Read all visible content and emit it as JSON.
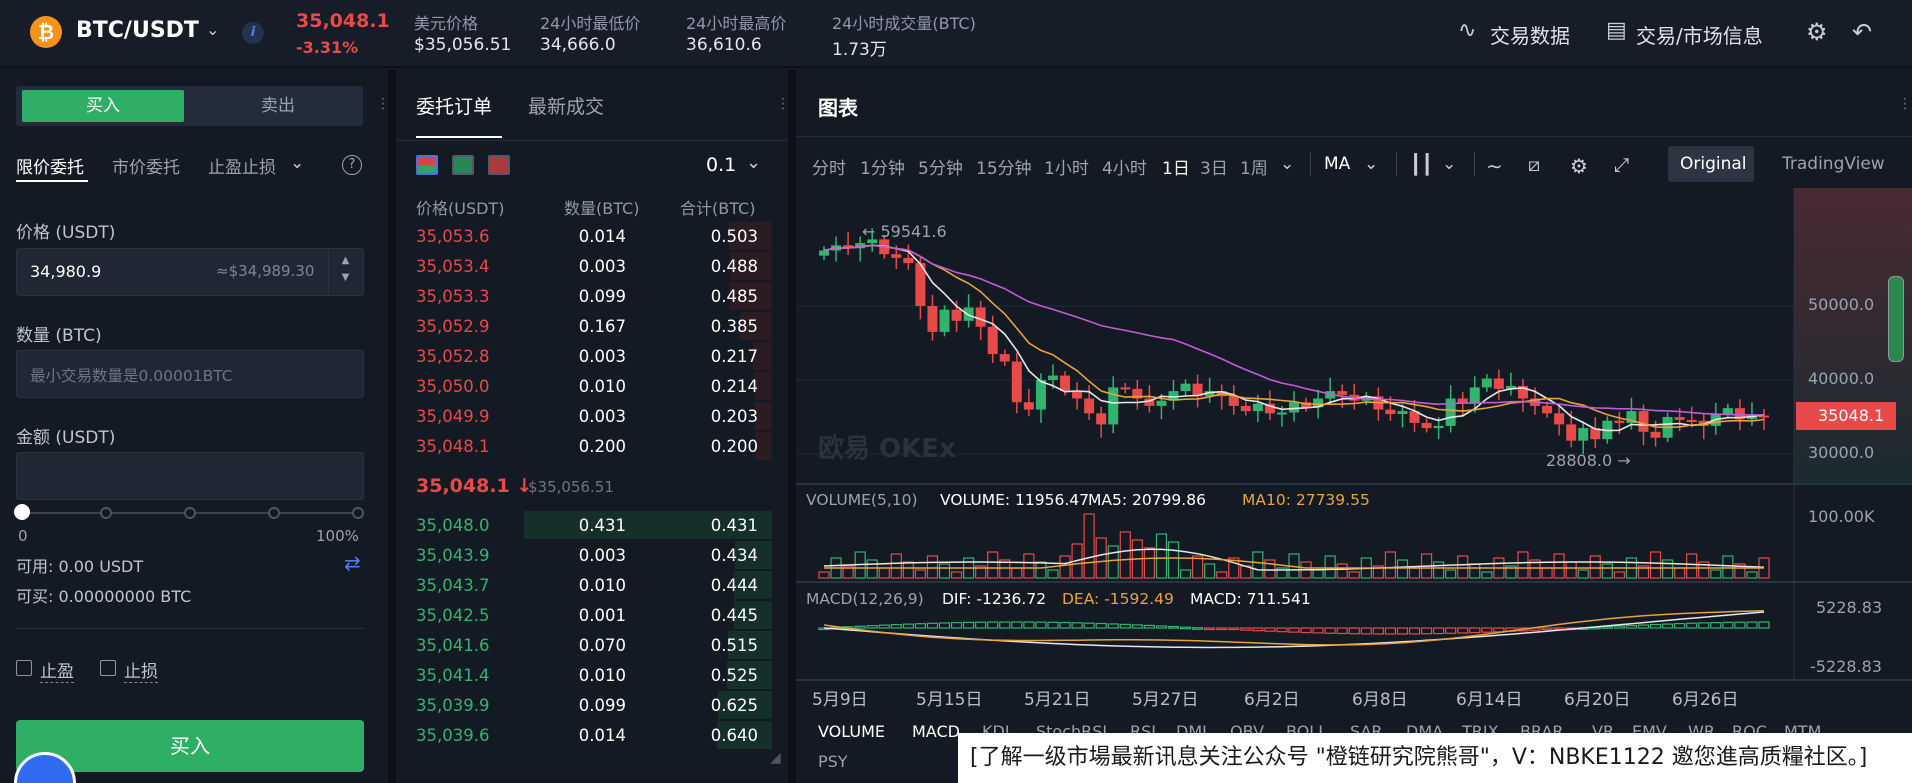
{
  "header": {
    "pair": "BTC/USDT",
    "last_price": "35,048.1",
    "change_pct": "-3.31%",
    "stats": [
      {
        "label": "美元价格",
        "value": "$35,056.51"
      },
      {
        "label": "24小时最低价",
        "value": "34,666.0"
      },
      {
        "label": "24小时最高价",
        "value": "36,610.6"
      },
      {
        "label": "24小时成交量(BTC)",
        "value": "1.73万"
      }
    ],
    "link_trade_data": "交易数据",
    "link_market_info": "交易/市场信息"
  },
  "trade": {
    "buy_tab": "买入",
    "sell_tab": "卖出",
    "order_types": [
      "限价委托",
      "市价委托",
      "止盈止损"
    ],
    "price_label": "价格 (USDT)",
    "price_value": "34,980.9",
    "price_usd": "≈$34,989.30",
    "qty_label": "数量 (BTC)",
    "qty_placeholder": "最小交易数量是0.00001BTC",
    "amount_label": "金额 (USDT)",
    "slider_min": "0",
    "slider_max": "100%",
    "slider_value_pct": 0,
    "available": "可用: 0.00 USDT",
    "can_buy": "可买: 0.00000000 BTC",
    "take_profit": "止盈",
    "stop_loss": "止损",
    "buy_button": "买入"
  },
  "orderbook": {
    "tab_orders": "委托订单",
    "tab_trades": "最新成交",
    "precision": "0.1",
    "col_price": "价格(USDT)",
    "col_qty": "数量(BTC)",
    "col_total": "合计(BTC)",
    "asks": [
      [
        "35,053.6",
        "0.014",
        "0.503"
      ],
      [
        "35,053.4",
        "0.003",
        "0.488"
      ],
      [
        "35,053.3",
        "0.099",
        "0.485"
      ],
      [
        "35,052.9",
        "0.167",
        "0.385"
      ],
      [
        "35,052.8",
        "0.003",
        "0.217"
      ],
      [
        "35,050.0",
        "0.010",
        "0.214"
      ],
      [
        "35,049.9",
        "0.003",
        "0.203"
      ],
      [
        "35,048.1",
        "0.200",
        "0.200"
      ]
    ],
    "mid_price": "35,048.1 ↓",
    "mid_usd": "$35,056.51",
    "bids": [
      [
        "35,048.0",
        "0.431",
        "0.431"
      ],
      [
        "35,043.9",
        "0.003",
        "0.434"
      ],
      [
        "35,043.7",
        "0.010",
        "0.444"
      ],
      [
        "35,042.5",
        "0.001",
        "0.445"
      ],
      [
        "35,041.6",
        "0.070",
        "0.515"
      ],
      [
        "35,041.4",
        "0.010",
        "0.525"
      ],
      [
        "35,039.9",
        "0.099",
        "0.625"
      ],
      [
        "35,039.6",
        "0.014",
        "0.640"
      ]
    ]
  },
  "chart": {
    "title": "图表",
    "intervals": [
      "分时",
      "1分钟",
      "5分钟",
      "15分钟",
      "1小时",
      "4小时",
      "1日",
      "3日",
      "1周"
    ],
    "active_interval": "1日",
    "ma_label": "MA",
    "view_original": "Original",
    "view_tv": "TradingView",
    "price_axis": [
      "50000.0",
      "40000.0",
      "30000.0"
    ],
    "current_price_tag": "35048.1",
    "high_marker": "← 59541.6",
    "low_marker": "28808.0 →",
    "watermark": "欧易 OKEx",
    "volume_legend": {
      "name": "VOLUME(5,10)",
      "vol": "VOLUME: 11956.47",
      "ma5": "MA5: 20799.86",
      "ma10": "MA10: 27739.55"
    },
    "volume_axis": "100.00K",
    "macd_legend": {
      "name": "MACD(12,26,9)",
      "dif": "DIF: -1236.72",
      "dea": "DEA: -1592.49",
      "macd": "MACD: 711.541"
    },
    "macd_axis_top": "5228.83",
    "macd_axis_bottom": "-5228.83",
    "x_dates": [
      "5月9日",
      "5月15日",
      "5月21日",
      "5月27日",
      "6月2日",
      "6月8日",
      "6月14日",
      "6月20日",
      "6月26日"
    ],
    "indicators": [
      "VOLUME",
      "MACD",
      "KDJ",
      "StochRSI",
      "RSI",
      "DMI",
      "OBV",
      "BOLL",
      "SAR",
      "DMA",
      "TRIX",
      "BRAR",
      "VR",
      "EMV",
      "WR",
      "ROC",
      "MTM",
      "PSY"
    ],
    "colors": {
      "up": "#31b46f",
      "down": "#e84a4a",
      "ma_white": "#e6e6e6",
      "ma_orange": "#e8a33a",
      "ma_purple": "#c35ad6"
    }
  },
  "banner": "[了解一级市場最新讯息关注公众号 \"橙链研究院熊哥\"，V：NBKE1122 邀您進高质糧社区。]"
}
